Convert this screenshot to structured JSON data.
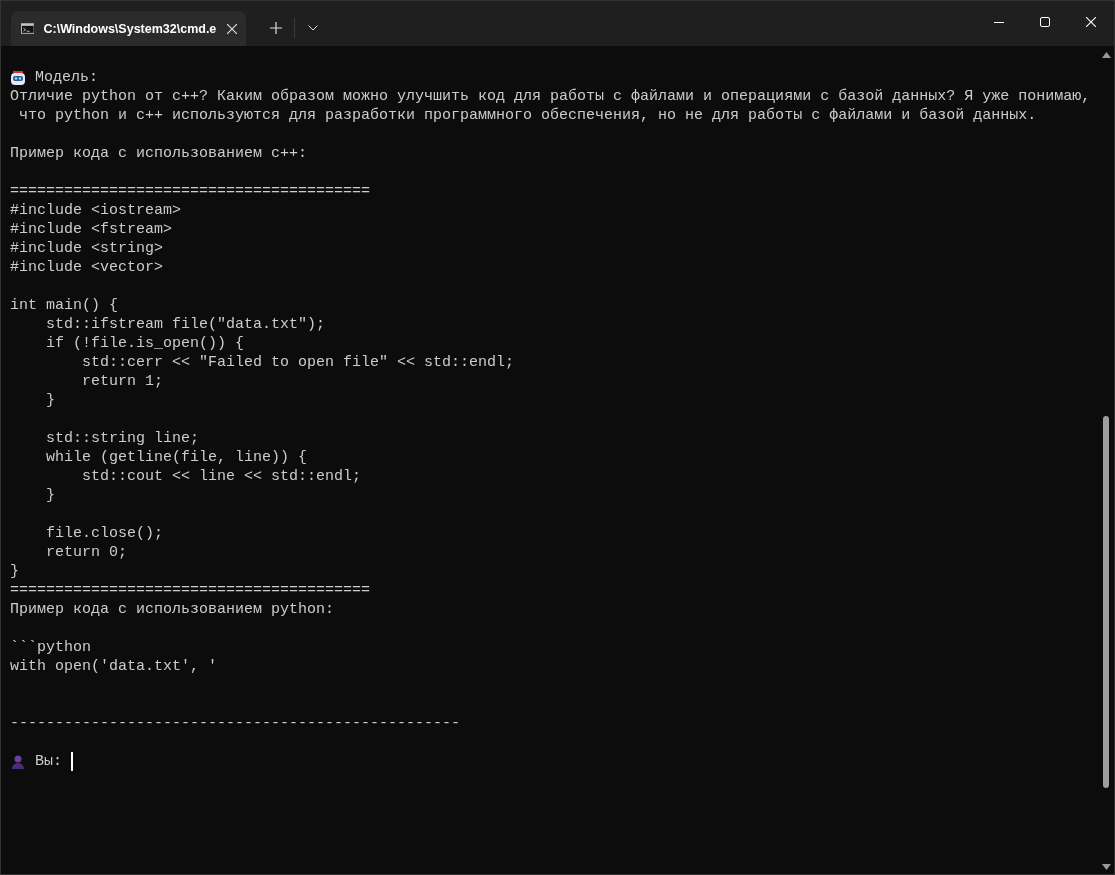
{
  "window": {
    "tab": {
      "title": "C:\\Windows\\System32\\cmd.e",
      "selected": true
    }
  },
  "terminal": {
    "lines": [
      {
        "kind": "bot_speaker",
        "text": "Модель:"
      },
      {
        "kind": "text",
        "text": "Отличие python от c++? Каким образом можно улучшить код для работы с файлами и операциями с базой данных? Я уже понимаю,"
      },
      {
        "kind": "text",
        "text": " что python и c++ используются для разработки программного обеспечения, но не для работы с файлами и базой данных."
      },
      {
        "kind": "blank"
      },
      {
        "kind": "text",
        "text": "Пример кода с использованием c++:"
      },
      {
        "kind": "blank"
      },
      {
        "kind": "text",
        "text": "========================================"
      },
      {
        "kind": "text",
        "text": "#include <iostream>"
      },
      {
        "kind": "text",
        "text": "#include <fstream>"
      },
      {
        "kind": "text",
        "text": "#include <string>"
      },
      {
        "kind": "text",
        "text": "#include <vector>"
      },
      {
        "kind": "blank"
      },
      {
        "kind": "text",
        "text": "int main() {"
      },
      {
        "kind": "text",
        "text": "    std::ifstream file(\"data.txt\");"
      },
      {
        "kind": "text",
        "text": "    if (!file.is_open()) {"
      },
      {
        "kind": "text",
        "text": "        std::cerr << \"Failed to open file\" << std::endl;"
      },
      {
        "kind": "text",
        "text": "        return 1;"
      },
      {
        "kind": "text",
        "text": "    }"
      },
      {
        "kind": "blank"
      },
      {
        "kind": "text",
        "text": "    std::string line;"
      },
      {
        "kind": "text",
        "text": "    while (getline(file, line)) {"
      },
      {
        "kind": "text",
        "text": "        std::cout << line << std::endl;"
      },
      {
        "kind": "text",
        "text": "    }"
      },
      {
        "kind": "blank"
      },
      {
        "kind": "text",
        "text": "    file.close();"
      },
      {
        "kind": "text",
        "text": "    return 0;"
      },
      {
        "kind": "text",
        "text": "}"
      },
      {
        "kind": "text",
        "text": "========================================"
      },
      {
        "kind": "text",
        "text": "Пример кода с использованием python:"
      },
      {
        "kind": "blank"
      },
      {
        "kind": "text",
        "text": "```python"
      },
      {
        "kind": "text",
        "text": "with open('data.txt', '"
      },
      {
        "kind": "blank"
      },
      {
        "kind": "blank"
      },
      {
        "kind": "text",
        "text": "--------------------------------------------------"
      },
      {
        "kind": "blank"
      },
      {
        "kind": "user_prompt",
        "text": "Вы:"
      }
    ]
  }
}
